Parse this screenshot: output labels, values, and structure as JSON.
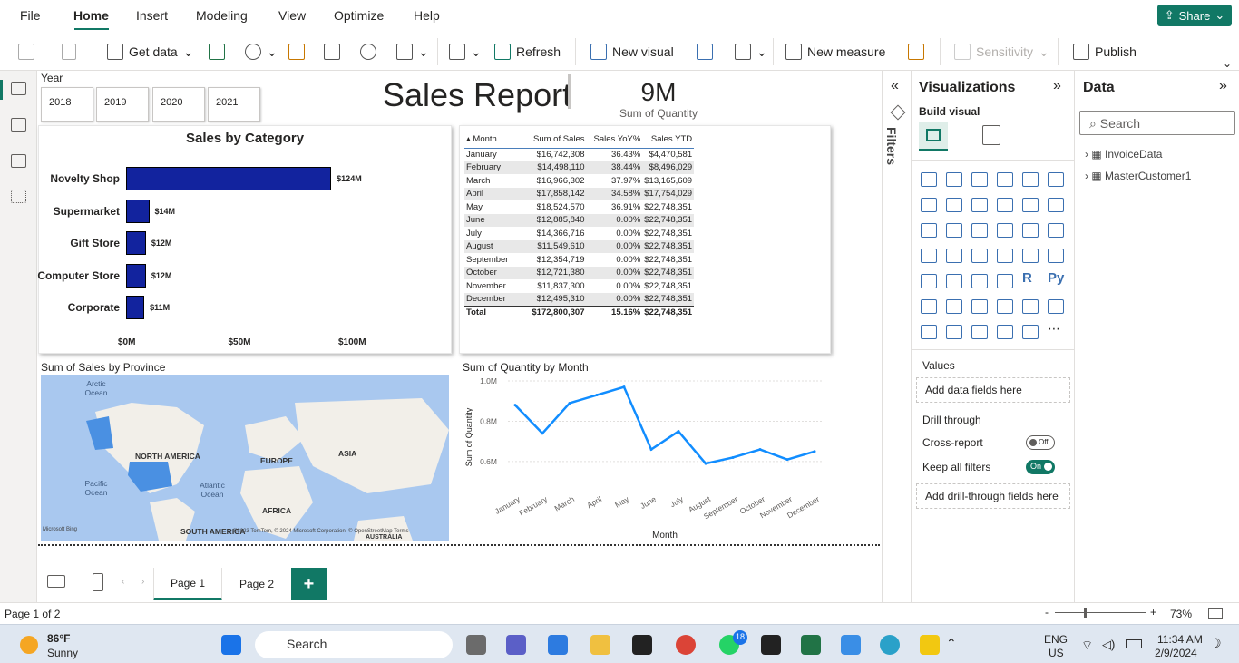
{
  "menu": {
    "file": "File",
    "home": "Home",
    "insert": "Insert",
    "modeling": "Modeling",
    "view": "View",
    "optimize": "Optimize",
    "help": "Help",
    "share": "Share"
  },
  "ribbon": {
    "get_data": "Get data",
    "refresh": "Refresh",
    "new_visual": "New visual",
    "new_measure": "New measure",
    "sensitivity": "Sensitivity",
    "publish": "Publish"
  },
  "report": {
    "slicer": {
      "label": "Year",
      "options": [
        "2018",
        "2019",
        "2020",
        "2021"
      ]
    },
    "title": "Sales Report",
    "kpi": {
      "value": "9M",
      "label": "Sum of Quantity"
    },
    "bar_title": "Sales by Category",
    "table": {
      "headers": [
        "Month",
        "Sum of Sales",
        "Sales YoY%",
        "Sales YTD"
      ],
      "rows": [
        [
          "January",
          "$16,742,308",
          "36.43%",
          "$4,470,581"
        ],
        [
          "February",
          "$14,498,110",
          "38.44%",
          "$8,496,029"
        ],
        [
          "March",
          "$16,966,302",
          "37.97%",
          "$13,165,609"
        ],
        [
          "April",
          "$17,858,142",
          "34.58%",
          "$17,754,029"
        ],
        [
          "May",
          "$18,524,570",
          "36.91%",
          "$22,748,351"
        ],
        [
          "June",
          "$12,885,840",
          "0.00%",
          "$22,748,351"
        ],
        [
          "July",
          "$14,366,716",
          "0.00%",
          "$22,748,351"
        ],
        [
          "August",
          "$11,549,610",
          "0.00%",
          "$22,748,351"
        ],
        [
          "September",
          "$12,354,719",
          "0.00%",
          "$22,748,351"
        ],
        [
          "October",
          "$12,721,380",
          "0.00%",
          "$22,748,351"
        ],
        [
          "November",
          "$11,837,300",
          "0.00%",
          "$22,748,351"
        ],
        [
          "December",
          "$12,495,310",
          "0.00%",
          "$22,748,351"
        ]
      ],
      "total": [
        "Total",
        "$172,800,307",
        "15.16%",
        "$22,748,351"
      ]
    },
    "map": {
      "title": "Sum of Sales by Province",
      "labels": {
        "arctic": "Arctic Ocean",
        "na": "NORTH AMERICA",
        "europe": "EUROPE",
        "asia": "ASIA",
        "pacific": "Pacific Ocean",
        "atlantic": "Atlantic Ocean",
        "africa": "AFRICA",
        "sa": "SOUTH AMERICA",
        "aus": "AUSTRALIA",
        "bing": "Microsoft Bing",
        "copyright": "©2023 TomTom, © 2024 Microsoft Corporation, © OpenStreetMap  Terms"
      }
    },
    "line_title": "Sum of Quantity by Month"
  },
  "chart_data": [
    {
      "type": "bar",
      "title": "Sales by Category",
      "categories": [
        "Novelty Shop",
        "Supermarket",
        "Gift Store",
        "Computer Store",
        "Corporate"
      ],
      "values": [
        124,
        14,
        12,
        12,
        11
      ],
      "value_labels": [
        "$124M",
        "$14M",
        "$12M",
        "$12M",
        "$11M"
      ],
      "x_ticks": [
        "$0M",
        "$50M",
        "$100M"
      ],
      "xlim": [
        0,
        130
      ],
      "color": "#12239e"
    },
    {
      "type": "line",
      "title": "Sum of Quantity by Month",
      "xlabel": "Month",
      "ylabel": "Sum of Quantity",
      "x": [
        "January",
        "February",
        "March",
        "April",
        "May",
        "June",
        "July",
        "August",
        "September",
        "October",
        "November",
        "December"
      ],
      "y": [
        0.88,
        0.74,
        0.89,
        0.93,
        0.97,
        0.66,
        0.75,
        0.59,
        0.62,
        0.66,
        0.61,
        0.65
      ],
      "y_ticks": [
        "0.6M",
        "0.8M",
        "1.0M"
      ],
      "ylim": [
        0.55,
        1.0
      ],
      "color": "#118dff"
    }
  ],
  "pages": {
    "tab1": "Page 1",
    "tab2": "Page 2",
    "add": "+"
  },
  "status": {
    "page_count": "Page 1 of 2",
    "zoom": "73%",
    "zoom_minus": "-",
    "zoom_plus": "+"
  },
  "filters_label": "Filters",
  "viz": {
    "title": "Visualizations",
    "build": "Build visual",
    "values": "Values",
    "add_data": "Add data fields here",
    "drill": "Drill through",
    "cross": "Cross-report",
    "cross_state": "Off",
    "keep": "Keep all filters",
    "keep_state": "On",
    "add_drill": "Add drill-through fields here",
    "r": "R",
    "py": "Py"
  },
  "data": {
    "title": "Data",
    "search": "Search",
    "tables": [
      "InvoiceData",
      "MasterCustomer1"
    ]
  },
  "taskbar": {
    "temp": "86°F",
    "weather": "Sunny",
    "search": "Search",
    "lang": "ENG",
    "region": "US",
    "time": "11:34 AM",
    "date": "2/9/2024",
    "badge": "18"
  }
}
